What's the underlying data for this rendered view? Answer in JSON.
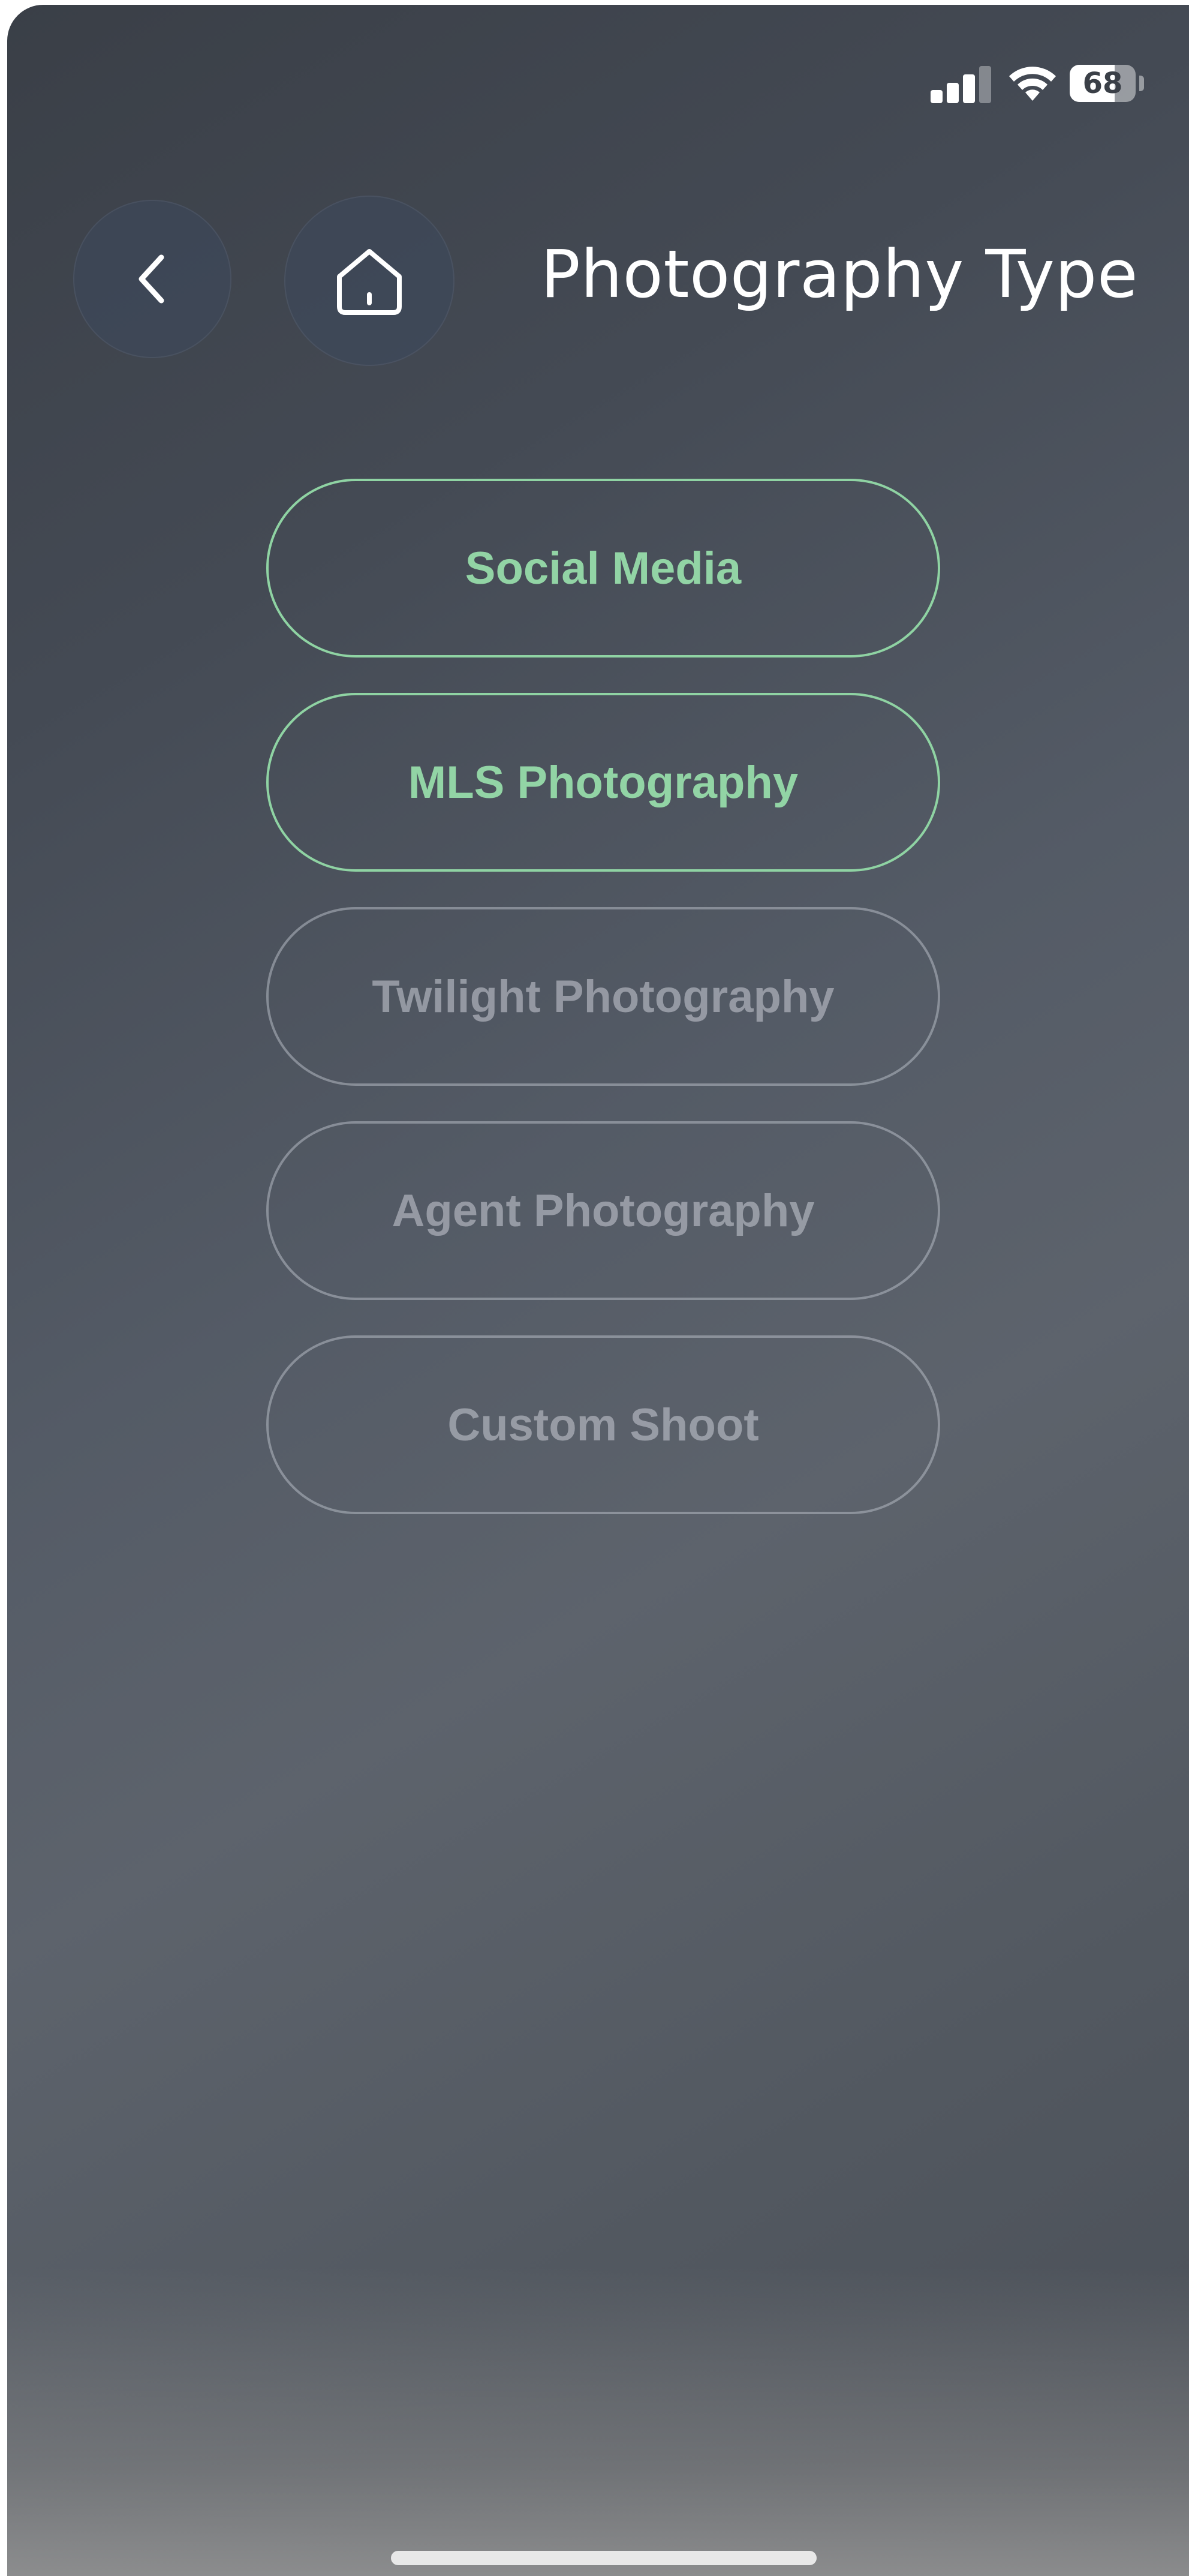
{
  "status_bar": {
    "battery_percent": "68",
    "battery_level": 0.68,
    "signal_bars_active": 3,
    "signal_bars_total": 4
  },
  "header": {
    "back_icon": "chevron-left-icon",
    "home_icon": "home-icon",
    "title": "Photography Type"
  },
  "options": [
    {
      "label": "Social Media",
      "selected": true
    },
    {
      "label": "MLS Photography",
      "selected": true
    },
    {
      "label": "Twilight Photography",
      "selected": false
    },
    {
      "label": "Agent Photography",
      "selected": false
    },
    {
      "label": "Custom Shoot",
      "selected": false
    }
  ],
  "colors": {
    "selected_accent": "#8fd3a3",
    "unselected_text": "#b9bcc4",
    "title_text": "#ffffff"
  }
}
